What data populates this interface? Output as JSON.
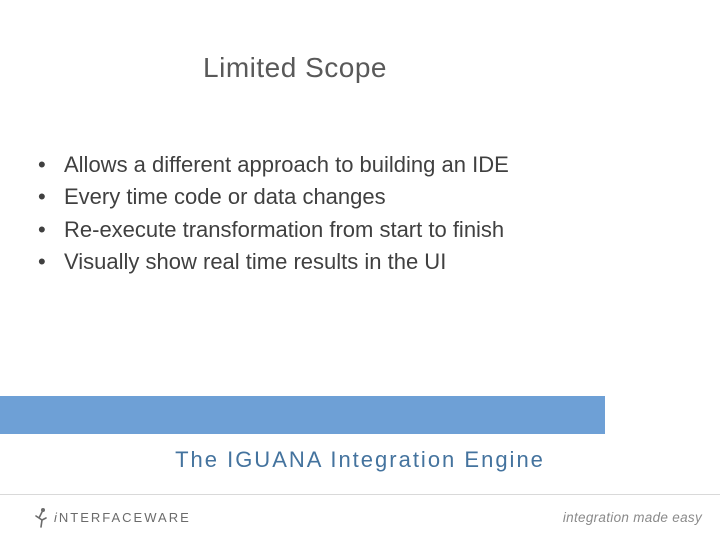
{
  "title": "Limited Scope",
  "bullets": [
    "Allows a different approach to building an IDE",
    "Every time code or data changes",
    "Re-execute transformation from start to finish",
    "Visually show real time results in the UI"
  ],
  "subtitle": "The IGUANA Integration Engine",
  "footer": {
    "logo_prefix": "i",
    "logo_text": "NTERFACEWARE",
    "tagline": "integration made easy"
  }
}
